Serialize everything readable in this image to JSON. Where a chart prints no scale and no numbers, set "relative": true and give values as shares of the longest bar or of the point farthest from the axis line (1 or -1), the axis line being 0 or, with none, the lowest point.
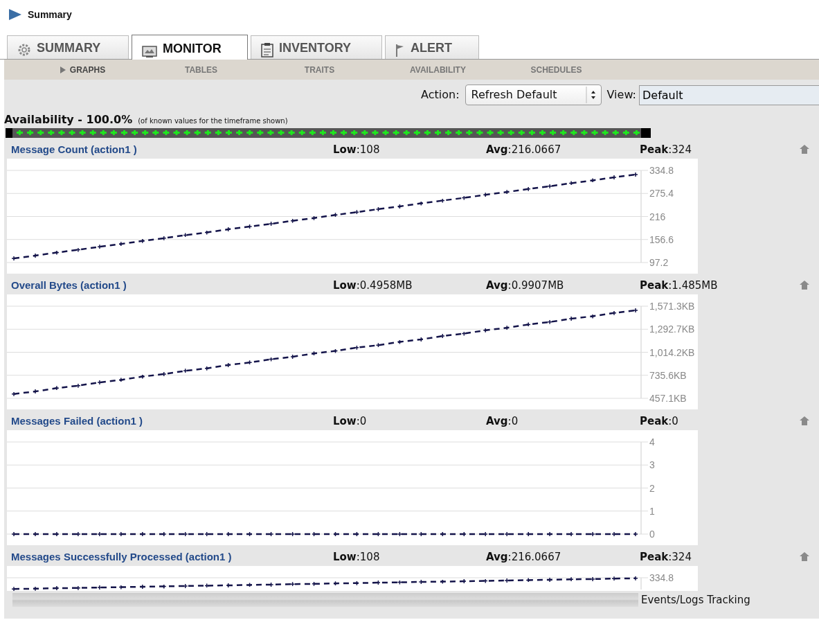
{
  "page_title": "Summary",
  "tabs": [
    {
      "label": "SUMMARY",
      "selected": false
    },
    {
      "label": "MONITOR",
      "selected": true
    },
    {
      "label": "INVENTORY",
      "selected": false
    },
    {
      "label": "ALERT",
      "selected": false
    }
  ],
  "subtabs": [
    {
      "label": "GRAPHS",
      "selected": true
    },
    {
      "label": "TABLES",
      "selected": false
    },
    {
      "label": "TRAITS",
      "selected": false
    },
    {
      "label": "AVAILABILITY",
      "selected": false
    },
    {
      "label": "SCHEDULES",
      "selected": false
    }
  ],
  "toolbar": {
    "action_label": "Action:",
    "action_value": "Refresh Default",
    "view_label": "View:",
    "view_value": "Default"
  },
  "availability": {
    "title": "Availability - 100.0%",
    "note": "(of known values for the timeframe shown)"
  },
  "metrics": [
    {
      "name": "Message Count (action1 )",
      "low_label": "Low",
      "low": ":108",
      "avg_label": "Avg",
      "avg": ":216.0667",
      "peak_label": "Peak",
      "peak": ":324",
      "chart_data": {
        "type": "line",
        "grid": true,
        "ylim": [
          97.2,
          334.8
        ],
        "yticks": [
          97.2,
          156.6,
          216,
          275.4,
          334.8
        ],
        "series": [
          {
            "color": "#14144a",
            "line_style": "dashed",
            "values": [
              108,
              115,
              123,
              130,
              138,
              145,
              153,
              160,
              168,
              175,
              183,
              190,
              197,
              205,
              212,
              220,
              227,
              235,
              242,
              250,
              257,
              264,
              272,
              279,
              287,
              294,
              302,
              309,
              317,
              324
            ]
          }
        ]
      }
    },
    {
      "name": "Overall Bytes (action1 )",
      "low_label": "Low",
      "low": ":0.4958MB",
      "avg_label": "Avg",
      "avg": ":0.9907MB",
      "peak_label": "Peak",
      "peak": ":1.485MB",
      "chart_data": {
        "type": "line",
        "grid": true,
        "ylim": [
          457.1,
          1571.3
        ],
        "yticks": [
          {
            "value": 457.1,
            "label": "457.1KB"
          },
          {
            "value": 735.6,
            "label": "735.6KB"
          },
          {
            "value": 1014.2,
            "label": "1,014.2KB"
          },
          {
            "value": 1292.7,
            "label": "1,292.7KB"
          },
          {
            "value": 1571.3,
            "label": "1,571.3KB"
          }
        ],
        "series": [
          {
            "color": "#14144a",
            "line_style": "dashed",
            "values": [
              510,
              540,
              580,
              610,
              650,
              680,
              720,
              750,
              790,
              820,
              860,
              890,
              930,
              960,
              1000,
              1030,
              1070,
              1100,
              1140,
              1170,
              1210,
              1240,
              1280,
              1310,
              1350,
              1380,
              1420,
              1450,
              1490,
              1520
            ]
          }
        ]
      }
    },
    {
      "name": "Messages Failed (action1 )",
      "low_label": "Low",
      "low": ":0",
      "avg_label": "Avg",
      "avg": ":0",
      "peak_label": "Peak",
      "peak": ":0",
      "chart_data": {
        "type": "line",
        "grid": true,
        "ylim": [
          0,
          4
        ],
        "yticks": [
          0,
          1,
          2,
          3,
          4
        ],
        "series": [
          {
            "color": "#14144a",
            "line_style": "dashed",
            "values": [
              0,
              0,
              0,
              0,
              0,
              0,
              0,
              0,
              0,
              0,
              0,
              0,
              0,
              0,
              0,
              0,
              0,
              0,
              0,
              0,
              0,
              0,
              0,
              0,
              0,
              0,
              0,
              0,
              0,
              0
            ]
          }
        ]
      }
    },
    {
      "name": "Messages Successfully Processed (action1 )",
      "low_label": "Low",
      "low": ":108",
      "avg_label": "Avg",
      "avg": ":216.0667",
      "peak_label": "Peak",
      "peak": ":324",
      "chart_data": {
        "type": "line",
        "relative": true,
        "annotations": [
          "334.8"
        ],
        "series": [
          {
            "color": "#14144a",
            "line_style": "dashed",
            "values": [
              0,
              0.03,
              0.07,
              0.1,
              0.14,
              0.17,
              0.21,
              0.24,
              0.28,
              0.31,
              0.34,
              0.38,
              0.41,
              0.45,
              0.48,
              0.52,
              0.55,
              0.59,
              0.62,
              0.66,
              0.69,
              0.72,
              0.76,
              0.79,
              0.83,
              0.86,
              0.9,
              0.93,
              0.97,
              1
            ]
          }
        ]
      }
    }
  ],
  "footer": {
    "link": "Events/Logs Tracking"
  }
}
